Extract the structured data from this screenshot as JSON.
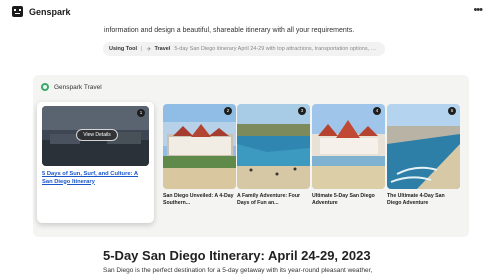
{
  "app": {
    "name": "Genspark"
  },
  "intro": {
    "text": "information and design a beautiful, shareable itinerary with all your requirements."
  },
  "tool": {
    "using_label": "Using Tool",
    "separator": "|",
    "name": "Travel",
    "query": "5-day San Diego itinerary April 24-29 with top attractions, transportation options, bea..."
  },
  "panel": {
    "title": "Genspark Travel"
  },
  "cards": [
    {
      "number": "1",
      "title": "5 Days of Sun, Surf, and Culture: A San Diego Itinerary",
      "button": "View Details"
    },
    {
      "number": "2",
      "title": "San Diego Unveiled: A 4-Day Southern..."
    },
    {
      "number": "3",
      "title": "A Family Adventure: Four Days of Fun an..."
    },
    {
      "number": "4",
      "title": "Ultimate 5-Day San Diego Adventure"
    },
    {
      "number": "5",
      "title": "The Ultimate 4-Day San Diego Adventure"
    }
  ],
  "content": {
    "heading": "5-Day San Diego Itinerary: April 24-29, 2023",
    "paragraph": "San Diego is the perfect destination for a 5-day getaway with its year-round pleasant weather,"
  },
  "icons": {
    "logo": "genspark-logo-icon",
    "more": "more-options-icon",
    "tool": "travel-tool-icon",
    "panel": "genspark-travel-icon"
  },
  "colors": {
    "link": "#1a56c8",
    "panel_bg": "#f4f4f2",
    "badge": "#1e1e1e"
  }
}
